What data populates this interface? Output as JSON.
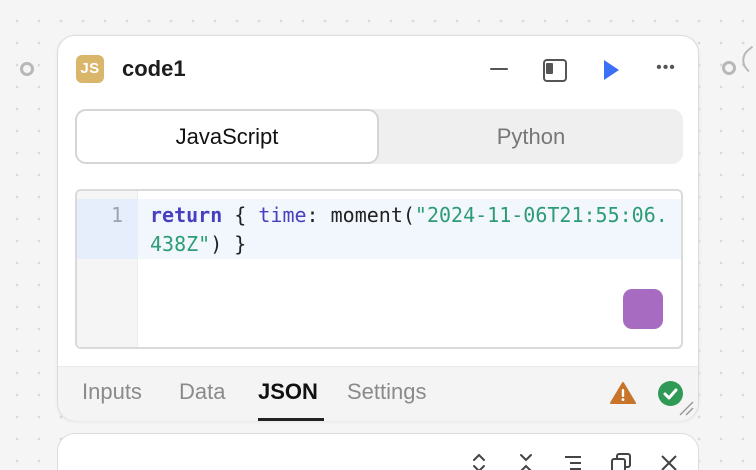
{
  "node": {
    "badge": "JS",
    "title": "code1",
    "header_icons": [
      "minimize-icon",
      "sidebar-icon",
      "play-icon",
      "more-icon"
    ],
    "more_glyph": "•••"
  },
  "lang_tabs": [
    {
      "label": "JavaScript",
      "active": true
    },
    {
      "label": "Python",
      "active": false
    }
  ],
  "editor": {
    "line_number": "1",
    "code": {
      "kw": "return",
      "brace_open": " { ",
      "prop": "time",
      "colon_fn": ": moment(",
      "str": "\"2024-11-06T21:55:06.438Z\"",
      "tail": ") }"
    }
  },
  "bottom_tabs": [
    {
      "label": "Inputs",
      "active": false
    },
    {
      "label": "Data",
      "active": false
    },
    {
      "label": "JSON",
      "active": true
    },
    {
      "label": "Settings",
      "active": false
    }
  ],
  "status_icons": [
    "warning-icon",
    "check-circle-icon"
  ],
  "colors": {
    "accent_blue": "#3b6ff5",
    "badge": "#d9b66a",
    "warning": "#c8742b",
    "success": "#2f9a55",
    "fab": "#a86bc2"
  },
  "second_node": {
    "icons": [
      "expand-vertical-icon",
      "collapse-vertical-icon",
      "list-indent-icon",
      "copy-icon",
      "close-icon"
    ]
  }
}
